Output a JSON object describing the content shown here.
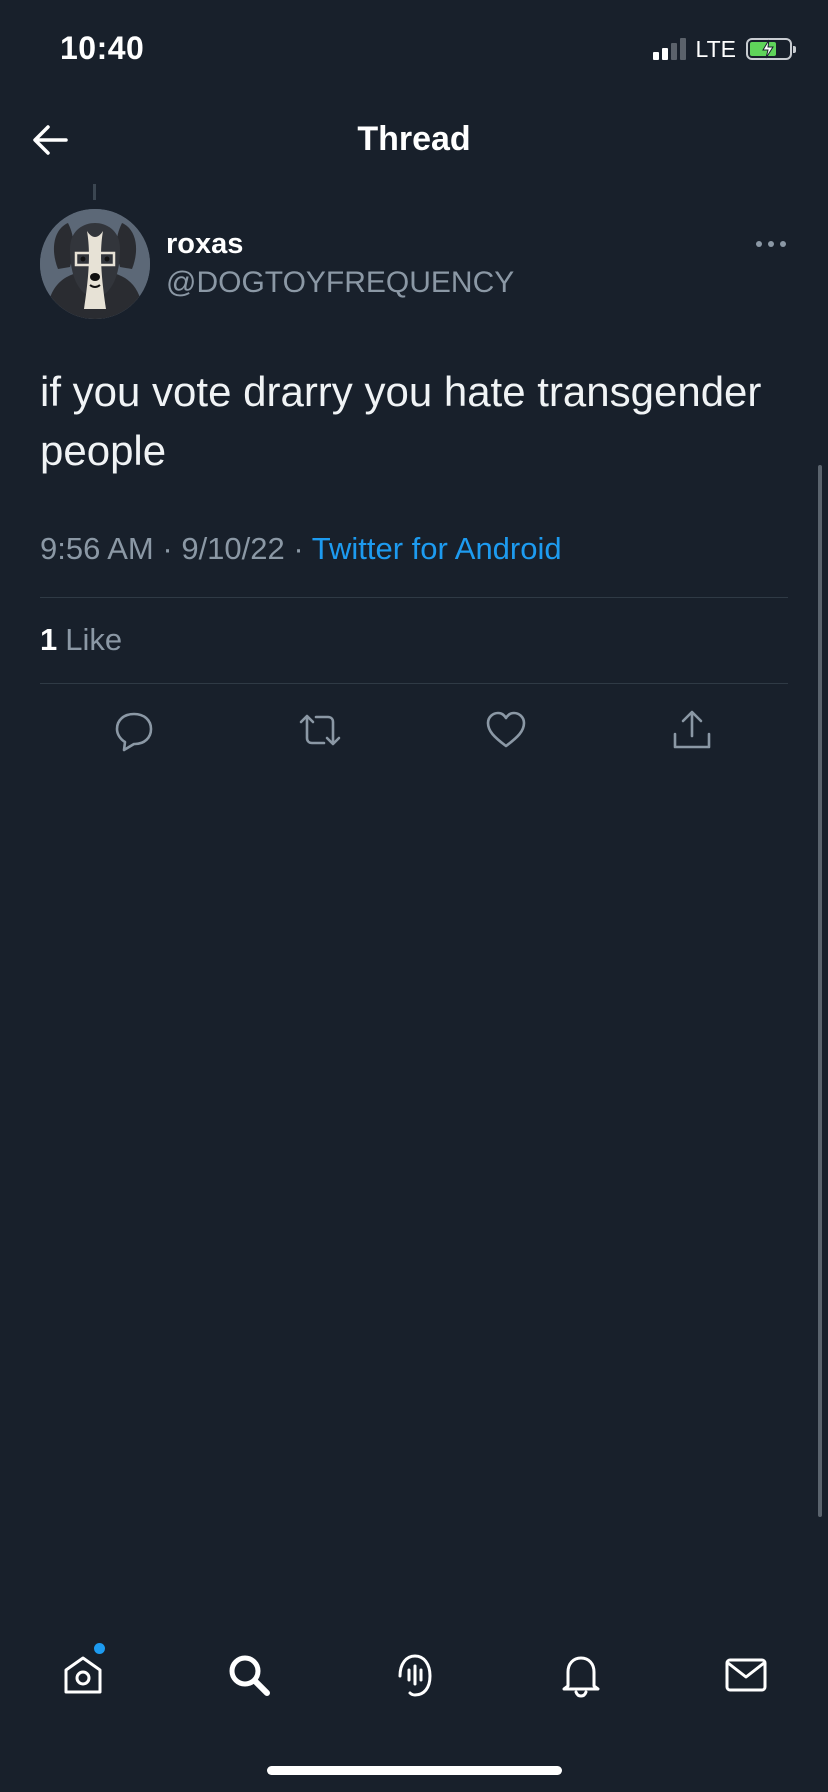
{
  "status_bar": {
    "time": "10:40",
    "network": "LTE",
    "signal_bars_active": 2,
    "signal_bars_total": 4,
    "battery_charging": true
  },
  "header": {
    "title": "Thread",
    "back_icon": "arrow-left-icon"
  },
  "tweet": {
    "display_name": "roxas",
    "handle": "@DOGTOYFREQUENCY",
    "text": "if you vote drarry you hate transgender people",
    "time": "9:56 AM",
    "date": "9/10/22",
    "separator": "·",
    "source": "Twitter for Android",
    "like_count": "1",
    "like_label": "Like"
  },
  "actions": [
    "reply-icon",
    "retweet-icon",
    "like-icon",
    "share-icon"
  ],
  "tab_bar": [
    "home-icon",
    "search-icon",
    "spaces-icon",
    "notifications-icon",
    "messages-icon"
  ],
  "colors": {
    "background": "#18202b",
    "accent": "#1d9bf0",
    "secondary_text": "#8b98a5",
    "divider": "#2f3a45",
    "battery_green": "#5fd45a"
  }
}
